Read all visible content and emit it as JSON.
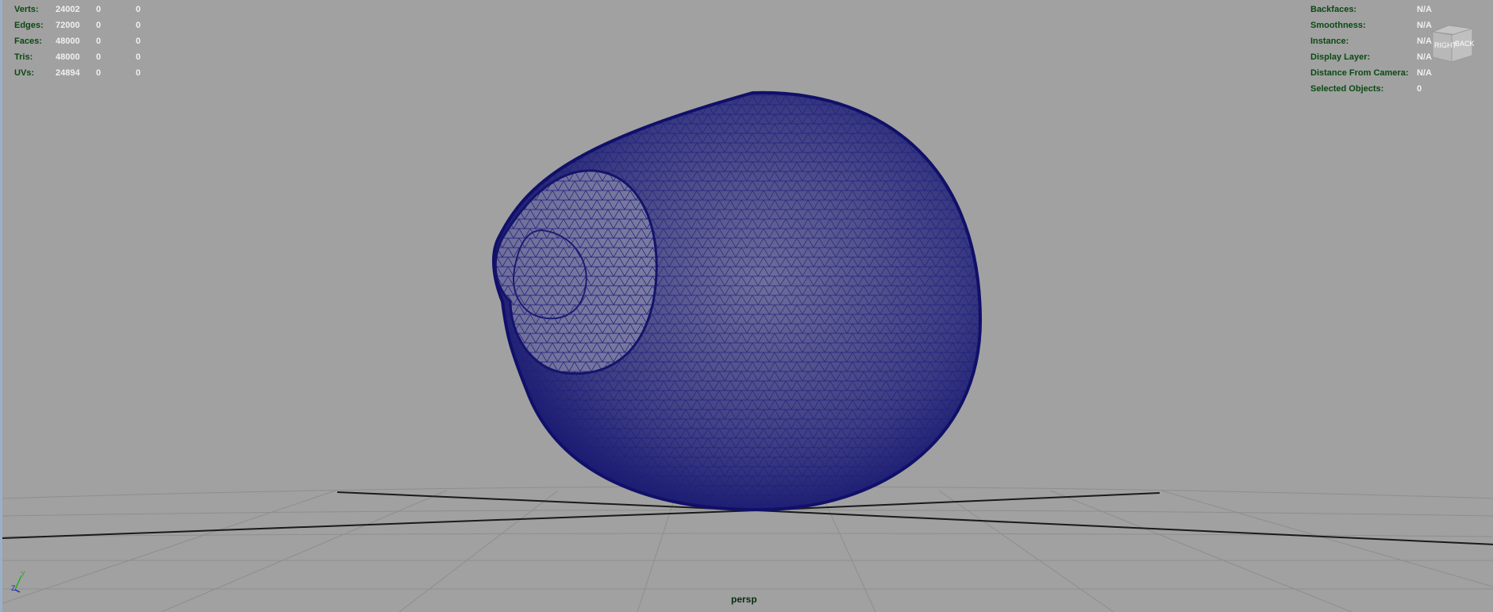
{
  "heads_up_left": {
    "rows": [
      {
        "label": "Verts:",
        "total": "24002",
        "selected": "0",
        "highlighted": "0"
      },
      {
        "label": "Edges:",
        "total": "72000",
        "selected": "0",
        "highlighted": "0"
      },
      {
        "label": "Faces:",
        "total": "48000",
        "selected": "0",
        "highlighted": "0"
      },
      {
        "label": "Tris:",
        "total": "48000",
        "selected": "0",
        "highlighted": "0"
      },
      {
        "label": "UVs:",
        "total": "24894",
        "selected": "0",
        "highlighted": "0"
      }
    ]
  },
  "heads_up_right": {
    "rows": [
      {
        "label": "Backfaces:",
        "value": "N/A"
      },
      {
        "label": "Smoothness:",
        "value": "N/A"
      },
      {
        "label": "Instance:",
        "value": "N/A"
      },
      {
        "label": "Display Layer:",
        "value": "N/A"
      },
      {
        "label": "Distance From Camera:",
        "value": "N/A"
      },
      {
        "label": "Selected Objects:",
        "value": "0"
      }
    ]
  },
  "view_cube": {
    "right_label": "RIGHT",
    "back_label": "BACK"
  },
  "camera": {
    "name": "persp"
  },
  "axis_gizmo": {
    "y_label": "Y",
    "z_label": "Z"
  },
  "colors": {
    "viewport_bg": "#a1a1a1",
    "wireframe": "#1a1a7a",
    "hud_label": "#0a4a12",
    "hud_value": "#f0f0f0"
  }
}
